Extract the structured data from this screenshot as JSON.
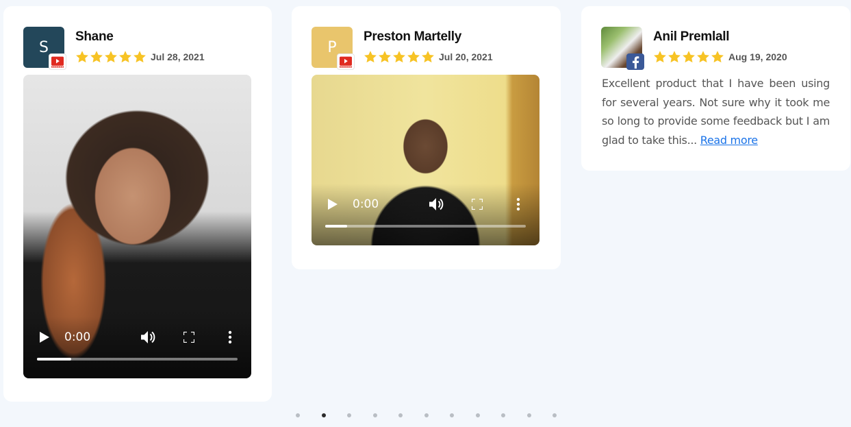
{
  "reviews": [
    {
      "name": "Shane",
      "avatar_letter": "S",
      "avatar_color": "#23475a",
      "source_icon": "youtube-icon",
      "date": "Jul 28, 2021",
      "rating": 5,
      "video": {
        "time": "0:00",
        "progress": 0.17
      }
    },
    {
      "name": "Preston Martelly",
      "avatar_letter": "P",
      "avatar_color": "#e9c56c",
      "source_icon": "youtube-icon",
      "date": "Jul 20, 2021",
      "rating": 5,
      "video": {
        "time": "0:00",
        "progress": 0.11
      }
    },
    {
      "name": "Anil Premlall",
      "avatar_letter": "",
      "source_icon": "facebook-icon",
      "date": "Aug 19, 2020",
      "rating": 5,
      "text": "Excellent product that I have been using for several years. Not sure why it took me so long to provide some feedback but I am glad to take this...",
      "read_more": "Read more"
    }
  ],
  "colors": {
    "star": "#f7c325",
    "link": "#1a73e8",
    "dot_active": "#2b2b2b",
    "dot_inactive": "#b9bec4"
  },
  "pagination": {
    "count": 11,
    "active_index": 1
  }
}
